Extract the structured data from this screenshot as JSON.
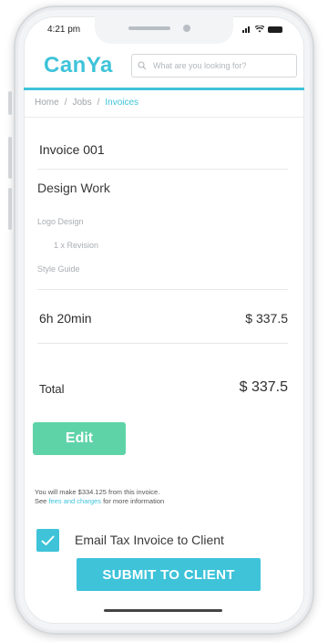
{
  "status_bar": {
    "time": "4:21 pm"
  },
  "app": {
    "logo": "CanYa"
  },
  "search": {
    "placeholder": "What are you looking for?"
  },
  "breadcrumb": {
    "items": [
      "Home",
      "Jobs",
      "Invoices"
    ],
    "separator": "/"
  },
  "invoice": {
    "title": "Invoice 001",
    "job_title": "Design Work",
    "items": [
      "Logo Design",
      "1 x Revision",
      "Style Guide"
    ],
    "hours": "6h 20min",
    "hours_amount": "$  337.5",
    "total_label": "Total",
    "total_amount": "$  337.5"
  },
  "actions": {
    "edit_label": "Edit",
    "submit_label": "SUBMIT TO CLIENT"
  },
  "note": {
    "line1": "You will make $334.125 from this invoice.",
    "line2_prefix": "See ",
    "line2_link": "fees and charges",
    "line2_suffix": " for more information"
  },
  "email_option": {
    "label": "Email Tax Invoice to Client",
    "checked": true
  },
  "colors": {
    "accent": "#3ec3d9",
    "edit_button": "#5ed3a7"
  }
}
